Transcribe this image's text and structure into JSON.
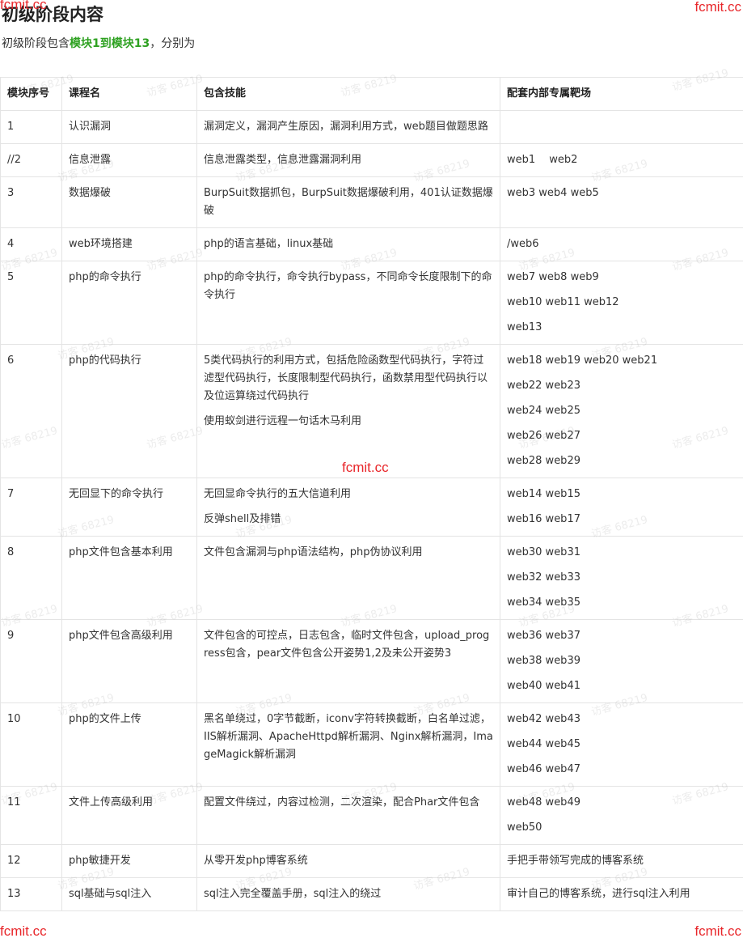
{
  "heading": "初级阶段内容",
  "intro": {
    "prefix": "初级阶段包含",
    "highlight": "模块1到模块13",
    "suffix": "，分别为"
  },
  "table": {
    "headers": [
      "模块序号",
      "课程名",
      "包含技能",
      "配套内部专属靶场"
    ],
    "rows": [
      {
        "no": "1",
        "course": "认识漏洞",
        "skills": [
          "漏洞定义，漏洞产生原因，漏洞利用方式，web题目做题思路"
        ],
        "ranges": [
          ""
        ]
      },
      {
        "no": "//2",
        "course": "信息泄露",
        "skills": [
          "信息泄露类型，信息泄露漏洞利用"
        ],
        "ranges": [
          "web1　 web2"
        ]
      },
      {
        "no": "3",
        "course": "数据爆破",
        "skills": [
          "BurpSuit数据抓包，BurpSuit数据爆破利用，401认证数据爆破"
        ],
        "ranges": [
          "web3  web4  web5"
        ]
      },
      {
        "no": "4",
        "course": "web环境搭建",
        "skills": [
          "php的语言基础，linux基础"
        ],
        "ranges": [
          "/web6"
        ]
      },
      {
        "no": "5",
        "course": "php的命令执行",
        "skills": [
          "php的命令执行，命令执行bypass，不同命令长度限制下的命令执行"
        ],
        "ranges": [
          "web7 web8 web9",
          "web10 web11 web12",
          "web13"
        ]
      },
      {
        "no": "6",
        "course": "php的代码执行",
        "skills": [
          "5类代码执行的利用方式，包括危险函数型代码执行，字符过滤型代码执行，长度限制型代码执行，函数禁用型代码执行以及位运算绕过代码执行",
          "使用蚁剑进行远程一句话木马利用"
        ],
        "ranges": [
          "web18 web19 web20 web21",
          "web22 web23",
          "web24 web25",
          "web26 web27",
          "web28 web29"
        ]
      },
      {
        "no": "7",
        "course": "无回显下的命令执行",
        "skills": [
          "无回显命令执行的五大信道利用",
          "反弹shell及排错"
        ],
        "ranges": [
          "web14 web15",
          "web16 web17"
        ]
      },
      {
        "no": "8",
        "course": "php文件包含基本利用",
        "skills": [
          "文件包含漏洞与php语法结构，php伪协议利用"
        ],
        "ranges": [
          "web30 web31",
          "web32 web33",
          "web34 web35"
        ]
      },
      {
        "no": "9",
        "course": "php文件包含高级利用",
        "skills": [
          "文件包含的可控点，日志包含，临时文件包含，upload_progress包含，pear文件包含公开姿势1,2及未公开姿势3"
        ],
        "ranges": [
          "web36 web37",
          "web38 web39",
          "web40 web41"
        ]
      },
      {
        "no": "10",
        "course": "php的文件上传",
        "skills": [
          "黑名单绕过，0字节截断，iconv字符转换截断，白名单过滤，IIS解析漏洞、ApacheHttpd解析漏洞、Nginx解析漏洞，ImageMagick解析漏洞"
        ],
        "ranges": [
          "web42 web43",
          "web44 web45",
          "web46 web47"
        ]
      },
      {
        "no": "11",
        "course": "文件上传高级利用",
        "skills": [
          "配置文件绕过，内容过检测，二次渲染，配合Phar文件包含"
        ],
        "ranges": [
          "web48 web49",
          "web50"
        ]
      },
      {
        "no": "12",
        "course": "php敏捷开发",
        "skills": [
          "从零开发php博客系统"
        ],
        "ranges": [
          "手把手带领写完成的博客系统"
        ]
      },
      {
        "no": "13",
        "course": "sql基础与sql注入",
        "skills": [
          "sql注入完全覆盖手册，sql注入的绕过"
        ],
        "ranges": [
          "审计自己的博客系统，进行sql注入利用"
        ]
      }
    ]
  },
  "watermark": {
    "text": "访客 68219",
    "brand": "fcmit.cc",
    "color": "#e8262a"
  }
}
